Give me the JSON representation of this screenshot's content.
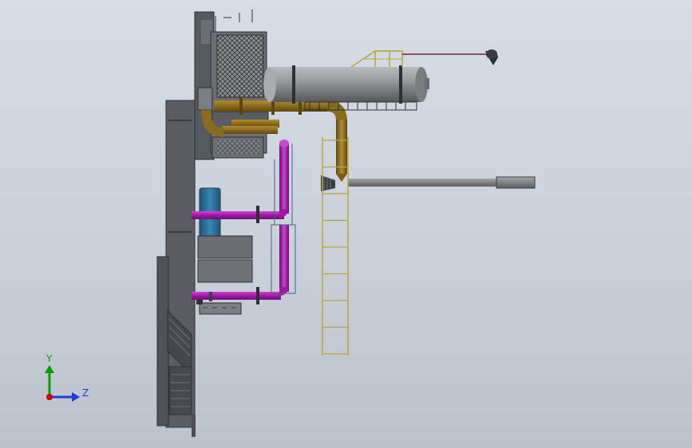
{
  "view": {
    "background_top": "#d7dde6",
    "background_bottom": "#bcc2cc"
  },
  "triad": {
    "y_label": "Y",
    "z_label": "Z",
    "y_color": "#00a000",
    "z_color": "#1a3fd6",
    "origin_color": "#d00000"
  },
  "colors": {
    "structure_dark": "#4a4d52",
    "structure_mid": "#6b6e73",
    "pipe_brown": "#8a6b1e",
    "pipe_magenta": "#a217a8",
    "vessel_gray": "#8d8f92",
    "ladder_yellow": "#b9a63a",
    "tank_blue": "#2c6b93",
    "pipe_long_gray": "#7a7c80"
  },
  "icons": {
    "axis_triad": "view-orientation-triad-icon"
  }
}
